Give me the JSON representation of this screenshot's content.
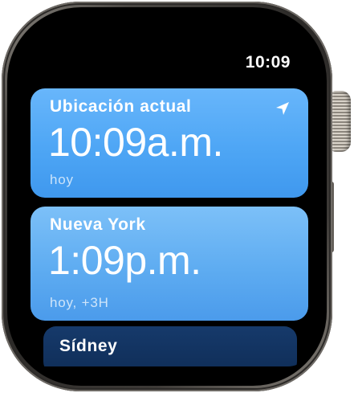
{
  "status": {
    "time": "10:09"
  },
  "clocks": [
    {
      "city": "Ubicación actual",
      "time": "10:09a.m.",
      "detail": "hoy",
      "icon": "location-arrow-icon"
    },
    {
      "city": "Nueva York",
      "time": "1:09p.m.",
      "detail": "hoy, +3H"
    },
    {
      "city": "Sídney"
    }
  ],
  "colors": {
    "card_current": "#4ea6f5",
    "card_secondary": "#5eacf1",
    "card_next": "#163a6b"
  }
}
